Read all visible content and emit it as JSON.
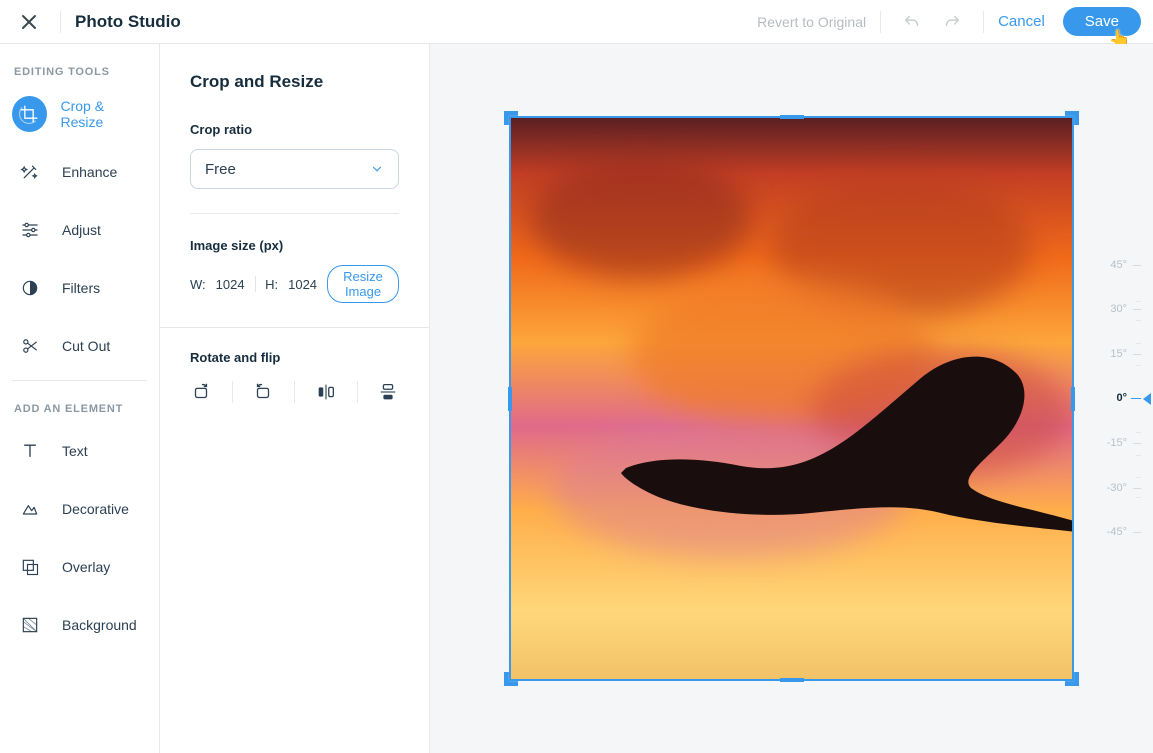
{
  "header": {
    "title": "Photo Studio",
    "revert": "Revert to Original",
    "cancel": "Cancel",
    "save": "Save"
  },
  "sidebar": {
    "groups": [
      {
        "title": "EDITING TOOLS",
        "items": [
          {
            "label": "Crop & Resize",
            "icon": "crop-icon",
            "active": true
          },
          {
            "label": "Enhance",
            "icon": "wand-icon"
          },
          {
            "label": "Adjust",
            "icon": "sliders-icon"
          },
          {
            "label": "Filters",
            "icon": "filter-icon"
          },
          {
            "label": "Cut Out",
            "icon": "scissors-icon"
          }
        ]
      },
      {
        "title": "ADD AN ELEMENT",
        "items": [
          {
            "label": "Text",
            "icon": "text-icon"
          },
          {
            "label": "Decorative",
            "icon": "shape-icon"
          },
          {
            "label": "Overlay",
            "icon": "overlay-icon"
          },
          {
            "label": "Background",
            "icon": "background-icon"
          }
        ]
      }
    ]
  },
  "panel": {
    "title": "Crop and Resize",
    "crop_ratio_label": "Crop ratio",
    "crop_ratio_value": "Free",
    "image_size_label": "Image size (px)",
    "width_label": "W:",
    "width_value": "1024",
    "height_label": "H:",
    "height_value": "1024",
    "resize_btn": "Resize Image",
    "rotate_label": "Rotate and flip"
  },
  "ruler": {
    "ticks": [
      "45°",
      "30°",
      "15°",
      "0°",
      "-15°",
      "-30°",
      "-45°"
    ],
    "active_index": 3
  },
  "colors": {
    "accent": "#3899ec"
  }
}
